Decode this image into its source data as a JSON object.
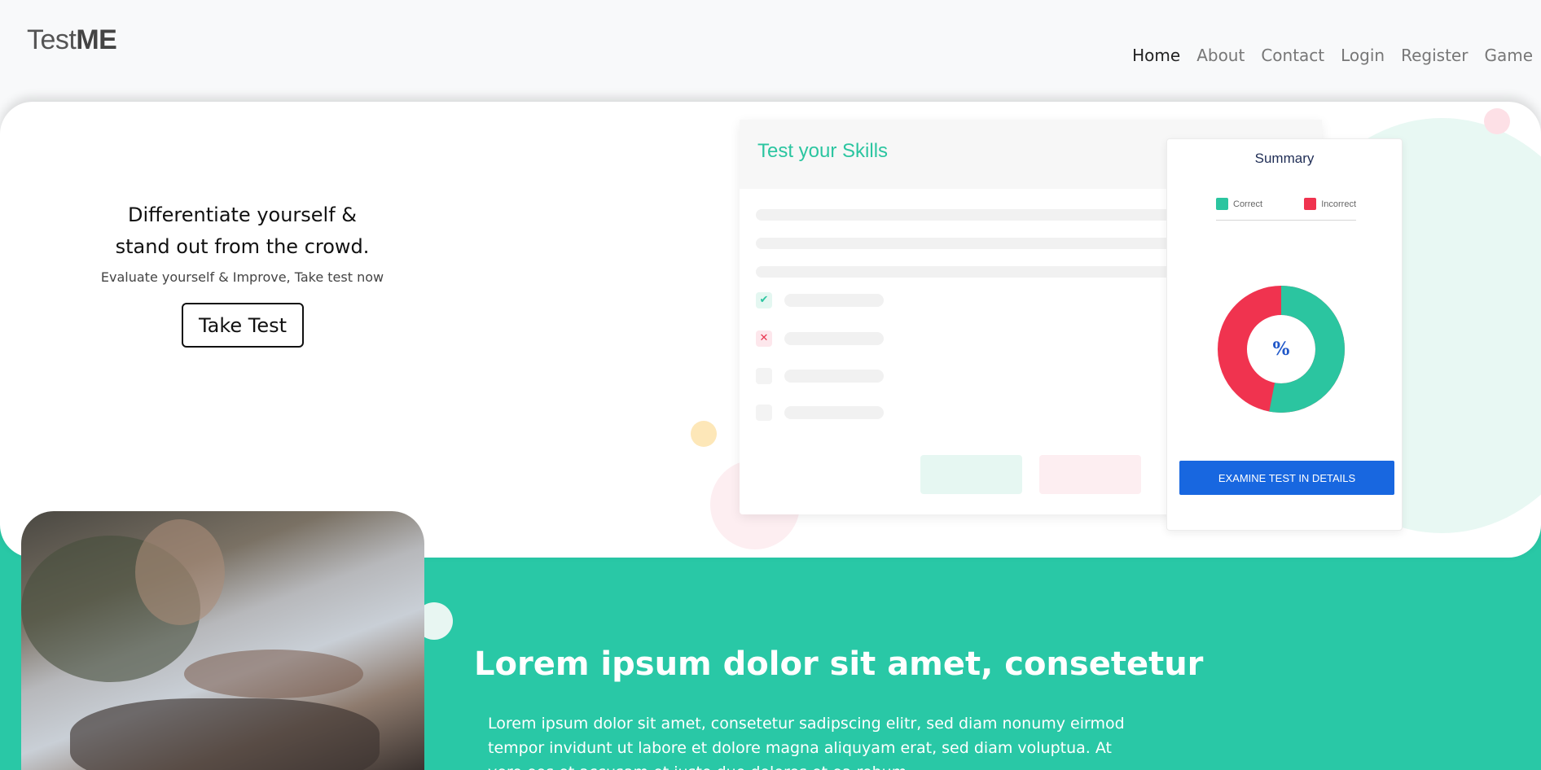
{
  "header": {
    "logo_light": "Test",
    "logo_bold": "ME",
    "nav": [
      "Home",
      "About",
      "Contact",
      "Login",
      "Register",
      "Game"
    ]
  },
  "hero": {
    "headline_line1": "Differentiate yourself &",
    "headline_line2": "stand out from the crowd.",
    "subtext": "Evaluate yourself & Improve, Take test now",
    "cta_label": "Take Test"
  },
  "test_card": {
    "title": "Test your Skills",
    "check_marks": [
      "✔",
      "✕"
    ]
  },
  "summary": {
    "title": "Summary",
    "legend": [
      {
        "label": "Correct",
        "color": "#2bc5a0"
      },
      {
        "label": "Incorrect",
        "color": "#f0334f"
      }
    ],
    "center_label": "%",
    "button_label": "EXAMINE TEST IN DETAILS",
    "correct_fraction": 0.53
  },
  "section": {
    "title": "Lorem ipsum dolor sit amet, consetetur",
    "text": "Lorem ipsum dolor sit amet, consetetur sadipscing elitr, sed diam nonumy eirmod tempor invidunt ut labore et dolore magna aliquyam erat, sed diam voluptua. At vero eos et accusam et justo duo dolores et ea rebum."
  },
  "colors": {
    "accent": "#29c8a6",
    "primary_button": "#1867e0",
    "incorrect": "#f0334f"
  }
}
